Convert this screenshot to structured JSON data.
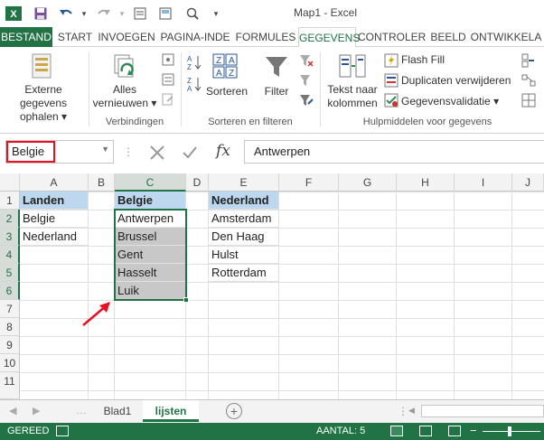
{
  "app": {
    "title": "Map1 - Excel",
    "excel_logo": "X"
  },
  "quick_access": [
    "excel-logo-icon",
    "save-icon",
    "undo-icon",
    "redo-icon",
    "customize-icon"
  ],
  "tabs": [
    {
      "label": "BESTAND"
    },
    {
      "label": "START"
    },
    {
      "label": "INVOEGEN"
    },
    {
      "label": "PAGINA-INDE"
    },
    {
      "label": "FORMULES"
    },
    {
      "label": "GEGEVENS"
    },
    {
      "label": "CONTROLER"
    },
    {
      "label": "BEELD"
    },
    {
      "label": "ONTWIKKELA"
    }
  ],
  "ribbon": {
    "external_data": {
      "line1": "Externe gegevens",
      "line2": "ophalen ▾"
    },
    "refresh_all": {
      "line1": "Alles",
      "line2": "vernieuwen ▾"
    },
    "group_connections": "Verbindingen",
    "sort": "Sorteren",
    "filter": "Filter",
    "group_sort_filter": "Sorteren en filteren",
    "text_to_columns": {
      "line1": "Tekst naar",
      "line2": "kolommen"
    },
    "flash_fill": "Flash Fill",
    "remove_duplicates": "Duplicaten verwijderen",
    "data_validation": "Gegevensvalidatie ▾",
    "group_data_tools": "Hulpmiddelen voor gegevens"
  },
  "formula_bar": {
    "name_box": "Belgie",
    "fx": "fx",
    "value": "Antwerpen"
  },
  "columns": [
    "A",
    "B",
    "C",
    "D",
    "E",
    "F",
    "G",
    "H",
    "I",
    "J"
  ],
  "rows": [
    "1",
    "2",
    "3",
    "4",
    "5",
    "6",
    "7",
    "8",
    "9",
    "10",
    "11"
  ],
  "cells": {
    "A1": "Landen",
    "A2": "Belgie",
    "A3": "Nederland",
    "C1": "Belgie",
    "C2": "Antwerpen",
    "C3": "Brussel",
    "C4": "Gent",
    "C5": "Hasselt",
    "C6": "Luik",
    "E1": "Nederland",
    "E2": "Amsterdam",
    "E3": "Den Haag",
    "E4": "Hulst",
    "E5": "Rotterdam"
  },
  "sheets": [
    {
      "label": "Blad1"
    },
    {
      "label": "lijsten"
    }
  ],
  "status": {
    "ready": "GEREED",
    "count": "AANTAL: 5"
  },
  "colors": {
    "excel_green": "#217346",
    "header_blue": "#bdd7ee",
    "selection_gray": "#c8c8c8",
    "highlight_red": "#e81123"
  }
}
